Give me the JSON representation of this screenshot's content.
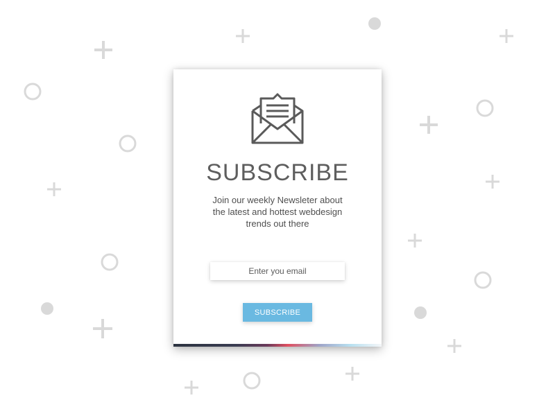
{
  "popup": {
    "title": "SUBSCRIBE",
    "description_lines": [
      "Join our weekly Newsleter about",
      "the latest and hottest webdesign",
      "trends out there"
    ],
    "email_placeholder": "Enter you email",
    "button_label": "SUBSCRIBE",
    "icon": "envelope-letter-icon"
  },
  "colors": {
    "button": "#6ab9e1",
    "title_text": "#5e5e5e",
    "background_shapes": "#d9d9d9",
    "icon_stroke": "#5a5a5a"
  }
}
